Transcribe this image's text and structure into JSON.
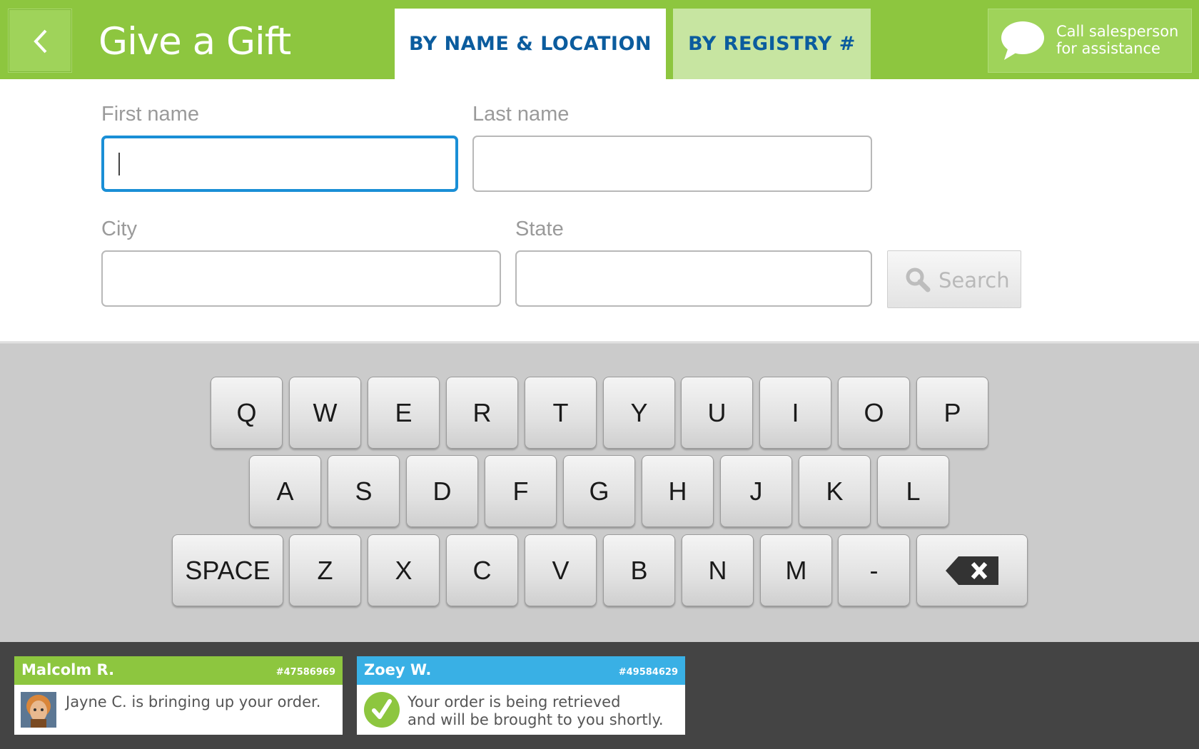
{
  "header": {
    "title": "Give a Gift",
    "back_icon": "chevron-left",
    "tabs": [
      {
        "label": "BY NAME & LOCATION",
        "active": true
      },
      {
        "label": "BY REGISTRY #",
        "active": false
      }
    ],
    "call_line1": "Call salesperson",
    "call_line2": "for assistance",
    "call_icon": "speech-bubble"
  },
  "form": {
    "first_name_label": "First name",
    "first_name_value": "",
    "last_name_label": "Last name",
    "last_name_value": "",
    "city_label": "City",
    "city_value": "",
    "state_label": "State",
    "state_value": "",
    "search_label": "Search",
    "search_icon": "magnifier"
  },
  "keyboard": {
    "row1": [
      "Q",
      "W",
      "E",
      "R",
      "T",
      "Y",
      "U",
      "I",
      "O",
      "P"
    ],
    "row2": [
      "A",
      "S",
      "D",
      "F",
      "G",
      "H",
      "J",
      "K",
      "L"
    ],
    "row3": [
      "SPACE",
      "Z",
      "X",
      "C",
      "V",
      "B",
      "N",
      "M",
      "-"
    ],
    "backspace_icon": "backspace"
  },
  "notifications": [
    {
      "name": "Malcolm R.",
      "order": "#47586969",
      "message_line1": "Jayne C. is bringing up your order.",
      "message_line2": "",
      "icon": "avatar"
    },
    {
      "name": "Zoey W.",
      "order": "#49584629",
      "message_line1": "Your order is being retrieved",
      "message_line2": "and will be brought to you shortly.",
      "icon": "check-circle"
    }
  ],
  "colors": {
    "header_green": "#8dc63f",
    "tab_inactive": "#c7e5a1",
    "tab_text": "#0b5c9e",
    "focus_blue": "#1a8fd6",
    "notify_blue": "#39b0e5",
    "footer_dark": "#444444"
  }
}
